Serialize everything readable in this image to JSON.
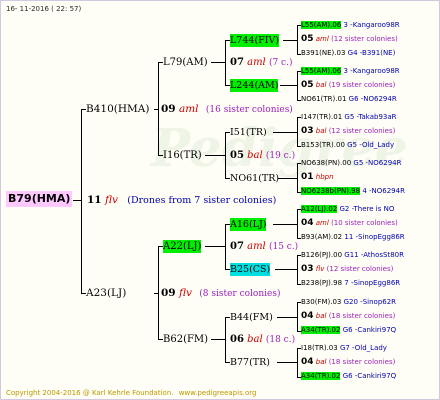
{
  "header": {
    "date": "16- 11-2016 ( 22: 57)"
  },
  "footer": {
    "copyright": "Copyright 2004-2016 @ Karl Kehrle Foundation.",
    "site": "www.pedigreeapis.org"
  },
  "watermark": "Pedigree",
  "root": {
    "name": "B79(HMA)",
    "year": "11",
    "race": "flv",
    "note": "(Drones from 7 sister colonies)"
  },
  "gen1": {
    "top": {
      "name": "B410(HMA)",
      "year": "09",
      "race": "aml",
      "note": "(16 sister colonies)"
    },
    "bottom": {
      "name": "A23(LJ)",
      "year": "09",
      "race": "flv",
      "note": "(8 sister colonies)"
    }
  },
  "gen2": {
    "a": {
      "name": "L79(AM)",
      "year": "07",
      "race": "aml",
      "note": "(7 c.)"
    },
    "b": {
      "name": "I16(TR)",
      "year": "05",
      "race": "bal",
      "note": "(19 c.)"
    },
    "c": {
      "name": "A22(LJ)",
      "year": "07",
      "race": "aml",
      "note": "(15 c.)"
    },
    "d": {
      "name": "B62(FM)",
      "year": "06",
      "race": "bal",
      "note": "(18 c.)"
    }
  },
  "gen3": {
    "a": {
      "name": "L744(FIV)"
    },
    "b": {
      "name": "L244(AM)"
    },
    "c": {
      "name": "I51(TR)"
    },
    "d": {
      "name": "NO61(TR)"
    },
    "e": {
      "name": "A16(LJ)"
    },
    "f": {
      "name": "B25(CS)"
    },
    "g": {
      "name": "B44(FM)"
    },
    "h": {
      "name": "B77(TR)"
    }
  },
  "gen4": [
    {
      "mother": "L55(AM)",
      "mother_year": ".06",
      "father": "3 -Kangaroo98R",
      "year": "05",
      "race": "aml",
      "note": "(12 sister colonies)",
      "drone_mother": "B391(NE)",
      "drone_year": ".03",
      "drone_father": "G4 -B391(NE)"
    },
    {
      "mother": "L55(AM)",
      "mother_year": ".06",
      "father": "3 -Kangaroo98R",
      "year": "05",
      "race": "bal",
      "note": "(19 sister colonies)",
      "drone_mother": "NO61(TR)",
      "drone_year": ".01",
      "drone_father": "G6 -NO6294R"
    },
    {
      "mother": "I147(TR)",
      "mother_year": ".01",
      "father": "G5 -Takab93aR",
      "year": "03",
      "race": "bal",
      "note": "(12 sister colonies)",
      "drone_mother": "B153(TR)",
      "drone_year": ".00",
      "drone_father": "G5 -Old_Lady"
    },
    {
      "mother": "NO638(PN)",
      "mother_year": ".00",
      "father": "G5 -NO6294R",
      "year": "01",
      "race": "hbpn",
      "note": "",
      "drone_mother": "NO6238b(PN)",
      "drone_year": ".98",
      "drone_father": "4 -NO6294R"
    },
    {
      "mother": "A12(LJ)",
      "mother_year": ".02",
      "father": "G2 -There is NO",
      "year": "04",
      "race": "aml",
      "note": "(10 sister colonies)",
      "drone_mother": "B93(AM)",
      "drone_year": ".02",
      "drone_father": "11 -SinopEgg86R"
    },
    {
      "mother": "B126(PJ)",
      "mother_year": ".00",
      "father": "G11 -AthosSt80R",
      "year": "03",
      "race": "flv",
      "note": "(12 sister colonies)",
      "drone_mother": "B238(PJ)",
      "drone_year": ".98",
      "drone_father": "7 -SinopEgg86R"
    },
    {
      "mother": "B30(FM)",
      "mother_year": ".03",
      "father": "G20 -Sinop62R",
      "year": "04",
      "race": "bal",
      "note": "(18 sister colonies)",
      "drone_mother": "A34(TR)",
      "drone_year": ".02",
      "drone_father": "G6 -Cankiri97Q"
    },
    {
      "mother": "I18(TR)",
      "mother_year": ".03",
      "father": "G7 -Old_Lady",
      "year": "04",
      "race": "bal",
      "note": "(18 sister colonies)",
      "drone_mother": "A34(TR)",
      "drone_year": ".02",
      "drone_father": "G6 -Cankiri97Q"
    }
  ]
}
